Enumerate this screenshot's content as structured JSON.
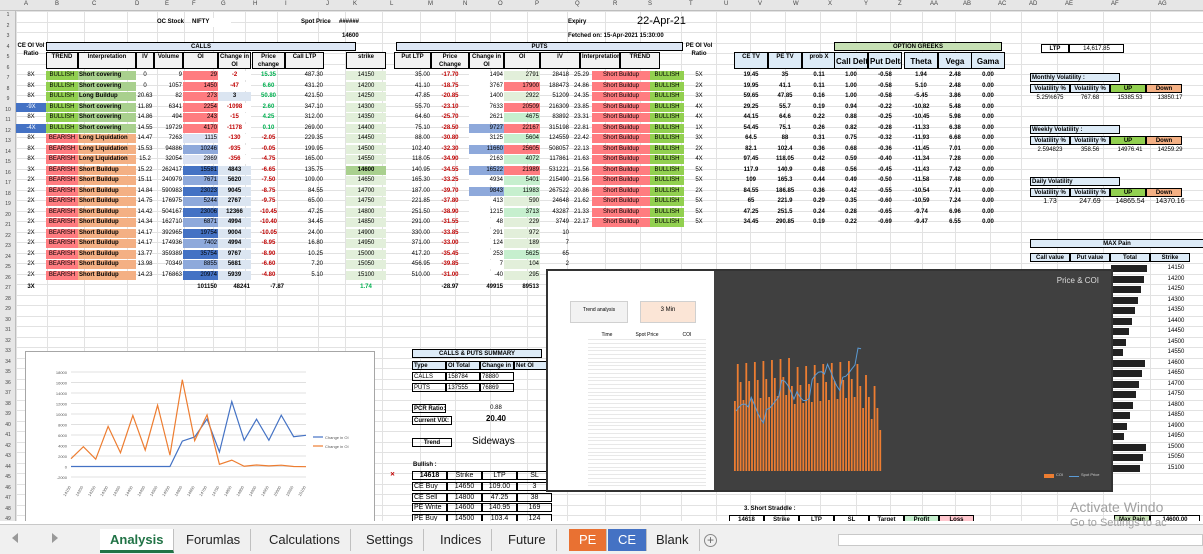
{
  "column_letters": [
    "A",
    "B",
    "C",
    "D",
    "E",
    "F",
    "G",
    "H",
    "I",
    "J",
    "K",
    "L",
    "M",
    "N",
    "O",
    "P",
    "Q",
    "R",
    "S",
    "T",
    "U",
    "V",
    "W",
    "X",
    "Y",
    "Z",
    "AA",
    "AB",
    "AC",
    "AD",
    "AE",
    "AF",
    "AG"
  ],
  "row_numbers": [
    "1",
    "2",
    "3",
    "4",
    "5",
    "6",
    "7",
    "8",
    "9",
    "10",
    "11",
    "12",
    "13",
    "14",
    "15",
    "16",
    "17",
    "18",
    "19",
    "20",
    "21",
    "22",
    "23",
    "24",
    "25",
    "26",
    "27",
    "28",
    "29",
    "30",
    "31",
    "32",
    "33",
    "34",
    "35",
    "36",
    "37",
    "38",
    "39",
    "40",
    "41",
    "42",
    "43",
    "44",
    "45",
    "46",
    "47",
    "48",
    "49",
    "50"
  ],
  "header": {
    "oc_stock_label": "OC Stock",
    "oc_stock_value": "NIFTY",
    "spot_price_label": "Spot Price",
    "spot_price_value": "######",
    "spot_value_2": "14600",
    "expiry_label": "Expiry",
    "expiry_value": "22-Apr-21",
    "fetched_on": "Fetched on: 15-Apr-2021 15:30:00"
  },
  "section_titles": {
    "calls": "CALLS",
    "puts": "PUTS",
    "option_greeks": "OPTION GREEKS",
    "ce_oi_vol": "CE OI Vol Ratio",
    "pe_oi_vol": "PE OI Vol Ratio",
    "max_pain": "MAX Pain"
  },
  "calls_columns": [
    "TREND",
    "Interpretation",
    "IV",
    "Volume",
    "OI",
    "Change in OI",
    "Price change",
    "Call LTP"
  ],
  "strike_header": "strike",
  "puts_columns": [
    "Put LTP",
    "Price Change",
    "Change in OI",
    "OI",
    "IV",
    "Interpretation",
    "TREND"
  ],
  "greeks_columns": [
    "CE TV",
    "PE TV",
    "prob X",
    "Call Delta",
    "Put Delta",
    "Theta",
    "Vega",
    "Gama"
  ],
  "rows": [
    {
      "r": "8X",
      "trend": "BULLISH",
      "interp": "Short covering",
      "iv": "0",
      "vol": "9",
      "oi": "29",
      "chg": "-2",
      "pchg": "15.35",
      "ltp": "487.30",
      "strike": "14150",
      "pltp": "35.00",
      "ppc": "-17.70",
      "pchgoi": "1494",
      "poi": "2791",
      "piv": "28418",
      "piv2": "25.29",
      "pinterp": "Short Buildup",
      "ptrend": "BULLISH",
      "pr": "5X"
    },
    {
      "r": "8X",
      "trend": "BULLISH",
      "interp": "Short covering",
      "iv": "0",
      "vol": "1057",
      "oi": "1450",
      "chg": "-47",
      "pchg": "6.60",
      "ltp": "431.20",
      "strike": "14200",
      "pltp": "41.10",
      "ppc": "-18.75",
      "pchgoi": "3767",
      "poi": "17900",
      "piv": "188473",
      "piv2": "24.86",
      "pinterp": "Short Buildup",
      "ptrend": "BULLISH",
      "pr": "2X"
    },
    {
      "r": "8X",
      "trend": "BULLISH",
      "interp": "Long Buildup",
      "iv": "20.63",
      "vol": "82",
      "oi": "273",
      "chg": "3",
      "pchg": "50.80",
      "ltp": "421.50",
      "strike": "14250",
      "pltp": "47.85",
      "ppc": "-20.85",
      "pchgoi": "1400",
      "poi": "2922",
      "piv": "51209",
      "piv2": "24.35",
      "pinterp": "Short Buildup",
      "ptrend": "BULLISH",
      "pr": "3X"
    },
    {
      "r": "-9X",
      "trend": "BULLISH",
      "interp": "Short covering",
      "iv": "11.89",
      "vol": "6341",
      "oi": "2254",
      "chg": "-1098",
      "pchg": "2.60",
      "ltp": "347.10",
      "strike": "14300",
      "pltp": "55.70",
      "ppc": "-23.10",
      "pchgoi": "7633",
      "poi": "20509",
      "piv": "216309",
      "piv2": "23.85",
      "pinterp": "Short Buildup",
      "ptrend": "BULLISH",
      "pr": "4X"
    },
    {
      "r": "8X",
      "trend": "BULLISH",
      "interp": "Short covering",
      "iv": "14.86",
      "vol": "494",
      "oi": "243",
      "chg": "-15",
      "pchg": "4.25",
      "ltp": "312.00",
      "strike": "14350",
      "pltp": "64.60",
      "ppc": "-25.70",
      "pchgoi": "2621",
      "poi": "4675",
      "piv": "83892",
      "piv2": "23.31",
      "pinterp": "Short Buildup",
      "ptrend": "BULLISH",
      "pr": "4X"
    },
    {
      "r": "-4X",
      "trend": "BULLISH",
      "interp": "Short covering",
      "iv": "14.55",
      "vol": "19729",
      "oi": "4170",
      "chg": "-1178",
      "pchg": "0.10",
      "ltp": "269.00",
      "strike": "14400",
      "pltp": "75.10",
      "ppc": "-28.50",
      "pchgoi": "9727",
      "poi": "22167",
      "piv": "315198",
      "piv2": "22.81",
      "pinterp": "Short Buildup",
      "ptrend": "BULLISH",
      "pr": "1X"
    },
    {
      "r": "8X",
      "trend": "BEARISH",
      "interp": "Long Liquidation",
      "iv": "14.47",
      "vol": "7263",
      "oi": "1115",
      "chg": "-130",
      "pchg": "-2.05",
      "ltp": "229.35",
      "strike": "14450",
      "pltp": "88.00",
      "ppc": "-30.80",
      "pchgoi": "3125",
      "poi": "5604",
      "piv": "124559",
      "piv2": "22.42",
      "pinterp": "Short Buildup",
      "ptrend": "BULLISH",
      "pr": "3X"
    },
    {
      "r": "8X",
      "trend": "BEARISH",
      "interp": "Long Liquidation",
      "iv": "15.53",
      "vol": "94886",
      "oi": "10246",
      "chg": "-935",
      "pchg": "-0.05",
      "ltp": "199.95",
      "strike": "14500",
      "pltp": "102.40",
      "ppc": "-32.30",
      "pchgoi": "11660",
      "poi": "25605",
      "piv": "508057",
      "piv2": "22.13",
      "pinterp": "Short Buildup",
      "ptrend": "BULLISH",
      "pr": "2X"
    },
    {
      "r": "8X",
      "trend": "BEARISH",
      "interp": "Long Liquidation",
      "iv": "15.2",
      "vol": "32054",
      "oi": "2869",
      "chg": "-356",
      "pchg": "-4.75",
      "ltp": "165.00",
      "strike": "14550",
      "pltp": "118.05",
      "ppc": "-34.90",
      "pchgoi": "2163",
      "poi": "4072",
      "piv": "117861",
      "piv2": "21.63",
      "pinterp": "Short Buildup",
      "ptrend": "BULLISH",
      "pr": "4X"
    },
    {
      "r": "3X",
      "trend": "BEARISH",
      "interp": "Short Buildup",
      "iv": "15.22",
      "vol": "262417",
      "oi": "15581",
      "chg": "4843",
      "pchg": "-6.65",
      "ltp": "135.75",
      "strike": "14600",
      "pltp": "140.95",
      "ppc": "-34.55",
      "pchgoi": "16522",
      "poi": "21989",
      "piv": "531221",
      "piv2": "21.56",
      "pinterp": "Short Buildup",
      "ptrend": "BULLISH",
      "pr": "5X"
    },
    {
      "r": "2X",
      "trend": "BEARISH",
      "interp": "Short Buildup",
      "iv": "15.11",
      "vol": "240979",
      "oi": "7671",
      "chg": "5620",
      "pchg": "-7.50",
      "ltp": "109.00",
      "strike": "14650",
      "pltp": "165.30",
      "ppc": "-33.25",
      "pchgoi": "4934",
      "poi": "5401",
      "piv": "215490",
      "piv2": "21.56",
      "pinterp": "Short Buildup",
      "ptrend": "BULLISH",
      "pr": "5X"
    },
    {
      "r": "2X",
      "trend": "BEARISH",
      "interp": "Short Buildup",
      "iv": "14.84",
      "vol": "590983",
      "oi": "23023",
      "chg": "9045",
      "pchg": "-8.75",
      "ltp": "84.55",
      "strike": "14700",
      "pltp": "187.00",
      "ppc": "-39.70",
      "pchgoi": "9843",
      "poi": "11983",
      "piv": "267522",
      "piv2": "20.86",
      "pinterp": "Short Buildup",
      "ptrend": "BULLISH",
      "pr": "2X"
    },
    {
      "r": "2X",
      "trend": "BEARISH",
      "interp": "Short Buildup",
      "iv": "14.75",
      "vol": "176975",
      "oi": "5244",
      "chg": "2767",
      "pchg": "-9.75",
      "ltp": "65.00",
      "strike": "14750",
      "pltp": "221.85",
      "ppc": "-37.80",
      "pchgoi": "413",
      "poi": "590",
      "piv": "24648",
      "piv2": "21.62",
      "pinterp": "Short Buildup",
      "ptrend": "BULLISH",
      "pr": "5X"
    },
    {
      "r": "2X",
      "trend": "BEARISH",
      "interp": "Short Buildup",
      "iv": "14.42",
      "vol": "504167",
      "oi": "23006",
      "chg": "12366",
      "pchg": "-10.45",
      "ltp": "47.25",
      "strike": "14800",
      "pltp": "251.50",
      "ppc": "-38.90",
      "pchgoi": "1215",
      "poi": "3713",
      "piv": "43287",
      "piv2": "21.33",
      "pinterp": "Short Buildup",
      "ptrend": "BULLISH",
      "pr": "5X"
    },
    {
      "r": "2X",
      "trend": "BEARISH",
      "interp": "Short Buildup",
      "iv": "14.34",
      "vol": "162710",
      "oi": "6871",
      "chg": "4994",
      "pchg": "-10.40",
      "ltp": "34.45",
      "strike": "14850",
      "pltp": "291.00",
      "ppc": "-31.55",
      "pchgoi": "48",
      "poi": "229",
      "piv": "3749",
      "piv2": "22.17",
      "pinterp": "Short Buildup",
      "ptrend": "BULLISH",
      "pr": "5X"
    },
    {
      "r": "2X",
      "trend": "BEARISH",
      "interp": "Short Buildup",
      "iv": "14.17",
      "vol": "392965",
      "oi": "19754",
      "chg": "9004",
      "pchg": "-10.05",
      "ltp": "24.00",
      "strike": "14900",
      "pltp": "330.00",
      "ppc": "-33.85",
      "pchgoi": "291",
      "poi": "972",
      "piv": "10",
      "piv2": "",
      "pinterp": "",
      "ptrend": "",
      "pr": ""
    },
    {
      "r": "2X",
      "trend": "BEARISH",
      "interp": "Short Buildup",
      "iv": "14.17",
      "vol": "174936",
      "oi": "7402",
      "chg": "4994",
      "pchg": "-8.95",
      "ltp": "16.80",
      "strike": "14950",
      "pltp": "371.00",
      "ppc": "-33.00",
      "pchgoi": "124",
      "poi": "189",
      "piv": "7",
      "piv2": "",
      "pinterp": "",
      "ptrend": "",
      "pr": ""
    },
    {
      "r": "2X",
      "trend": "BEARISH",
      "interp": "Short Buildup",
      "iv": "13.77",
      "vol": "359389",
      "oi": "35754",
      "chg": "9767",
      "pchg": "-8.90",
      "ltp": "10.25",
      "strike": "15000",
      "pltp": "417.20",
      "ppc": "-35.45",
      "pchgoi": "253",
      "poi": "5625",
      "piv": "65",
      "piv2": "",
      "pinterp": "",
      "ptrend": "",
      "pr": ""
    },
    {
      "r": "2X",
      "trend": "BEARISH",
      "interp": "Short Buildup",
      "iv": "13.98",
      "vol": "70349",
      "oi": "8855",
      "chg": "5681",
      "pchg": "-6.60",
      "ltp": "7.20",
      "strike": "15050",
      "pltp": "456.95",
      "ppc": "-39.85",
      "pchgoi": "7",
      "poi": "104",
      "piv": "2",
      "piv2": "",
      "pinterp": "",
      "ptrend": "",
      "pr": ""
    },
    {
      "r": "2X",
      "trend": "BEARISH",
      "interp": "Short Buildup",
      "iv": "14.23",
      "vol": "176863",
      "oi": "20974",
      "chg": "5939",
      "pchg": "-4.80",
      "ltp": "5.10",
      "strike": "15100",
      "pltp": "510.00",
      "ppc": "-31.00",
      "pchgoi": "-40",
      "poi": "295",
      "piv": "3",
      "piv2": "",
      "pinterp": "",
      "ptrend": "",
      "pr": ""
    }
  ],
  "greeks_rows": [
    [
      "19.45",
      "35",
      "0.11",
      "1.00",
      "-0.58",
      "1.94",
      "2.48",
      "0.00"
    ],
    [
      "19.95",
      "41.1",
      "0.11",
      "1.00",
      "-0.58",
      "5.10",
      "2.48",
      "0.00"
    ],
    [
      "59.65",
      "47.85",
      "0.16",
      "1.00",
      "-0.58",
      "-5.45",
      "3.86",
      "0.00"
    ],
    [
      "29.25",
      "55.7",
      "0.19",
      "0.94",
      "-0.22",
      "-10.82",
      "5.48",
      "0.00"
    ],
    [
      "44.15",
      "64.6",
      "0.22",
      "0.88",
      "-0.25",
      "-10.45",
      "5.98",
      "0.00"
    ],
    [
      "54.45",
      "75.1",
      "0.26",
      "0.82",
      "-0.28",
      "-11.33",
      "6.38",
      "0.00"
    ],
    [
      "64.5",
      "88",
      "0.31",
      "0.75",
      "-0.32",
      "-11.93",
      "6.68",
      "0.00"
    ],
    [
      "82.1",
      "102.4",
      "0.36",
      "0.68",
      "-0.36",
      "-11.45",
      "7.01",
      "0.00"
    ],
    [
      "97.45",
      "118.05",
      "0.42",
      "0.59",
      "-0.40",
      "-11.34",
      "7.28",
      "0.00"
    ],
    [
      "117.9",
      "140.9",
      "0.48",
      "0.56",
      "-0.45",
      "-11.43",
      "7.42",
      "0.00"
    ],
    [
      "109",
      "165.3",
      "0.44",
      "0.49",
      "-0.50",
      "-11.58",
      "7.48",
      "0.00"
    ],
    [
      "84.55",
      "186.85",
      "0.36",
      "0.42",
      "-0.55",
      "-10.54",
      "7.41",
      "0.00"
    ],
    [
      "65",
      "221.9",
      "0.29",
      "0.35",
      "-0.60",
      "-10.59",
      "7.24",
      "0.00"
    ],
    [
      "47.25",
      "251.5",
      "0.24",
      "0.28",
      "-0.65",
      "-9.74",
      "6.96",
      "0.00"
    ],
    [
      "34.45",
      "290.85",
      "0.19",
      "0.22",
      "-0.69",
      "-9.47",
      "6.55",
      "0.00"
    ]
  ],
  "totals": {
    "calls_label": "3X",
    "calls_oi_total": "101150",
    "calls_chg_total": "48241",
    "calls_pchg_total": "-7.87",
    "ratio": "1.74",
    "puts_pchg_total": "-28.97",
    "puts_chg_total": "49915",
    "puts_oi_total": "89513"
  },
  "ltp_box": {
    "label": "LTP",
    "value": "14,617.85"
  },
  "volatility": {
    "monthly_label": "Monthly Volatility :",
    "weekly_label": "Weekly Volatility :",
    "daily_label": "Daily Volatility",
    "col_vol": "Volatility %",
    "col_up": "UP",
    "col_down": "Down",
    "monthly_values": [
      "5.25%675",
      "767.68",
      "15385.53",
      "13850.17"
    ],
    "weekly_values": [
      "2.594823",
      "358.56",
      "14976.41",
      "14259.29"
    ],
    "daily_values": [
      "1.73",
      "247.69",
      "14865.54",
      "14370.16"
    ]
  },
  "max_pain": {
    "headers": [
      "Call value",
      "Put value",
      "Total",
      "Strike"
    ],
    "strikes": [
      "14150",
      "14200",
      "14250",
      "14300",
      "14350",
      "14400",
      "14450",
      "14500",
      "14550",
      "14600",
      "14650",
      "14700",
      "14750",
      "14800",
      "14850",
      "14900",
      "14950",
      "15000",
      "15050",
      "15100"
    ],
    "label": "Max Pain",
    "value": "14600.00"
  },
  "summary": {
    "title": "CALLS & PUTS SUMMARY",
    "cols": [
      "Type",
      "OI Total",
      "Change in OI",
      "Net OI"
    ],
    "calls": [
      "CALLS",
      "158784",
      "78880"
    ],
    "puts": [
      "PUTS",
      "137555",
      "76869"
    ],
    "pcr_label": "PCR Ratio:",
    "pcr_value": "0.88",
    "vix_label": "Current VIX:",
    "vix_value": "20.40",
    "trend_label": "Trend",
    "trend_value": "Sideways"
  },
  "bullish": {
    "label": "Bullish :",
    "header": [
      "14618",
      "Strike",
      "LTP",
      "SL"
    ],
    "rows": [
      [
        "CE Buy",
        "14650",
        "109.00",
        "3"
      ],
      [
        "CE Sell",
        "14800",
        "47.25",
        "38"
      ],
      [
        "PE Write",
        "14600",
        "140.95",
        "169"
      ],
      [
        "PE Buy",
        "14500",
        "103.4",
        "124"
      ]
    ]
  },
  "short_straddle": {
    "label": "3. Short Straddle :",
    "cols": [
      "14618",
      "Strike",
      "LTP",
      "SL",
      "Target",
      "Profit",
      "Loss"
    ]
  },
  "line_chart": {
    "type": "line",
    "series": [
      {
        "name": "Change in OI",
        "color": "#4472c4",
        "values": [
          0,
          0,
          0,
          0,
          0,
          0,
          0,
          0,
          0,
          4843,
          5620,
          9045,
          2767,
          12366,
          4994,
          9004,
          4994,
          9767,
          5681,
          5939
        ]
      },
      {
        "name": "Change in OI",
        "color": "#ed7d31",
        "values": [
          1494,
          3767,
          1400,
          7633,
          2621,
          9727,
          3125,
          11660,
          2163,
          16522,
          4934,
          9843,
          413,
          1215,
          48,
          291,
          124,
          253,
          7,
          -40
        ]
      }
    ],
    "categories": [
      "14150",
      "14200",
      "14250",
      "14300",
      "14350",
      "14400",
      "14450",
      "14500",
      "14550",
      "14600",
      "14650",
      "14700",
      "14750",
      "14800",
      "14850",
      "14900",
      "14950",
      "15000",
      "15050",
      "15100"
    ],
    "y_ticks": [
      "-2000",
      "0",
      "2000",
      "4000",
      "6000",
      "8000",
      "10000",
      "12000",
      "14000",
      "16000",
      "18000"
    ]
  },
  "price_oi_chart": {
    "title": "Price & COI",
    "btn1": "Trend analysis",
    "btn2": "3 Min",
    "legend_bars": "COI",
    "legend_line": "Spot Price",
    "table_headers": [
      "Time",
      "Spot Price",
      "COI"
    ]
  },
  "tabs": [
    "Analysis",
    "Forumlas",
    "Calculations",
    "Settings",
    "Indices",
    "Future",
    "PE",
    "CE",
    "Blank"
  ],
  "watermark": {
    "line1": "Activate Windo",
    "line2": "Go to Settings to ac"
  }
}
